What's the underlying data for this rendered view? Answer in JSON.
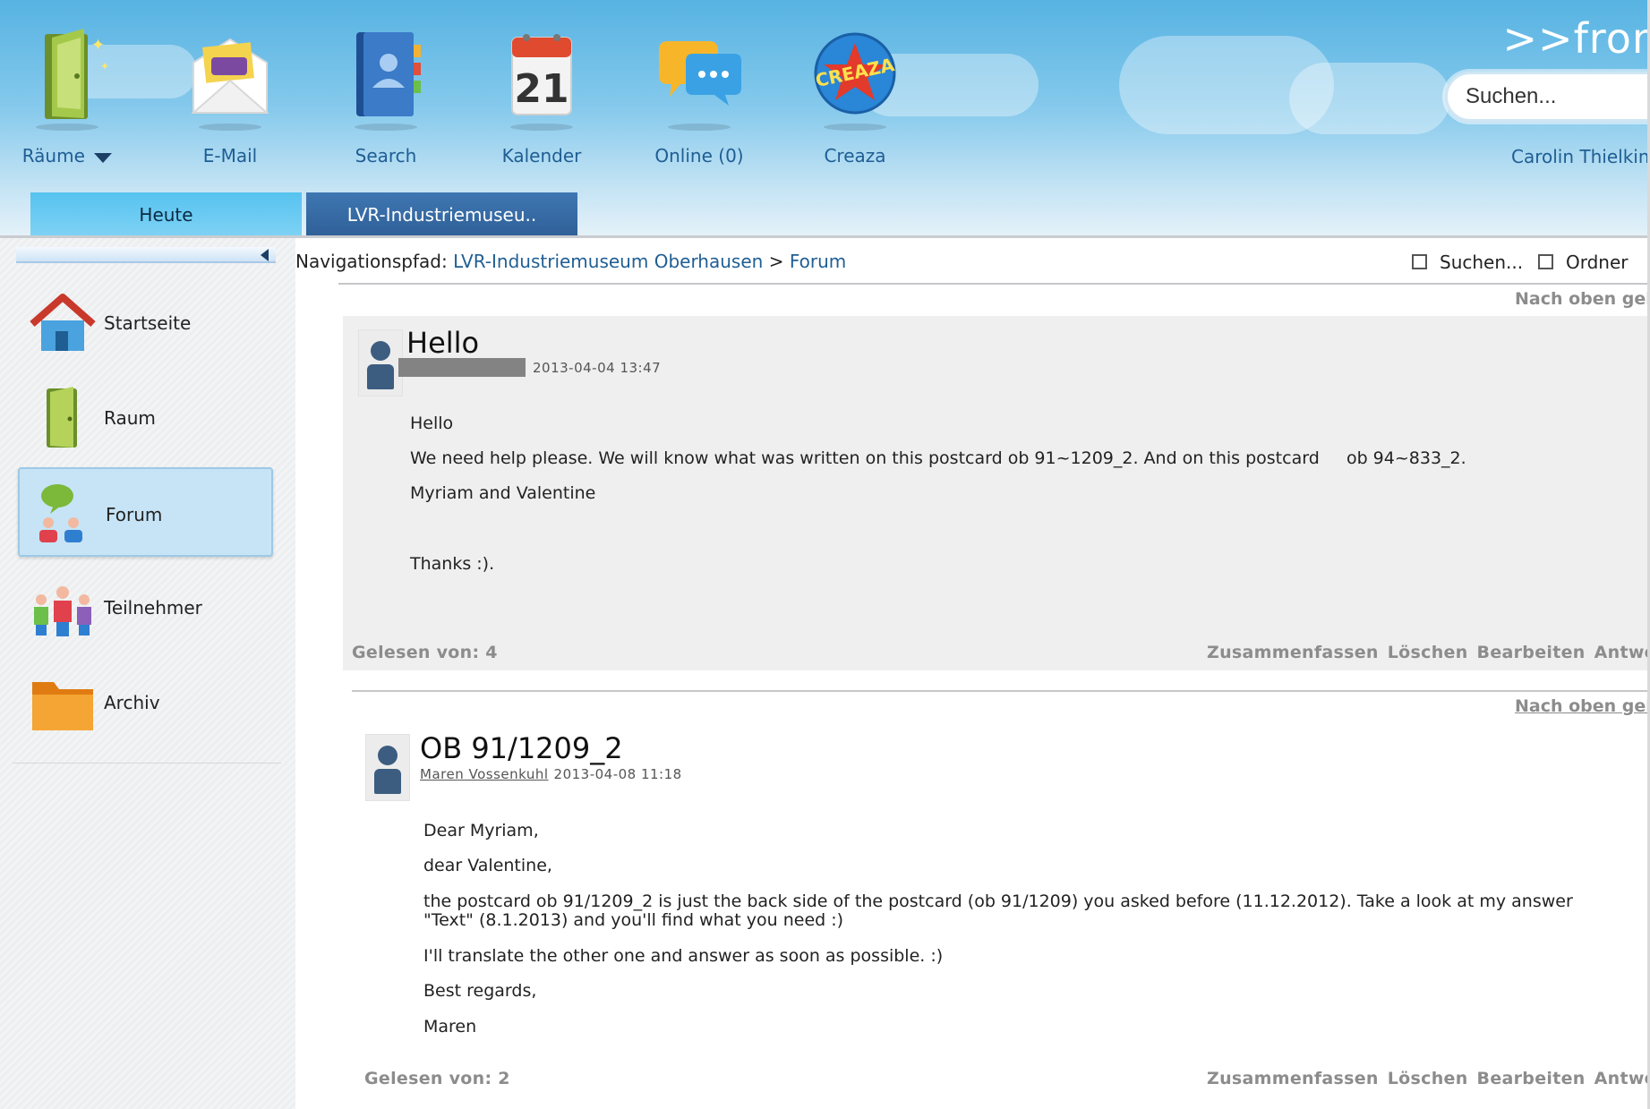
{
  "toolbar": {
    "items": [
      {
        "label": "Räume",
        "icon": "door-icon"
      },
      {
        "label": "E-Mail",
        "icon": "envelope-icon"
      },
      {
        "label": "Search",
        "icon": "address-book-icon"
      },
      {
        "label": "Kalender",
        "icon": "calendar-icon"
      },
      {
        "label": "Online (0)",
        "icon": "chat-bubbles-icon"
      },
      {
        "label": "Creaza",
        "icon": "creaza-logo-icon"
      }
    ],
    "calendar_day": "21",
    "creaza_badge": "CREAZA"
  },
  "header": {
    "brand": ">>fron",
    "search_placeholder": "Suchen...",
    "user_name": "Carolin Thielking"
  },
  "tabs": {
    "today": "Heute",
    "room": "LVR-Industriemuseu.."
  },
  "sidebar": {
    "items": [
      {
        "label": "Startseite",
        "icon": "house-icon"
      },
      {
        "label": "Raum",
        "icon": "door-icon"
      },
      {
        "label": "Forum",
        "icon": "forum-icon",
        "active": true
      },
      {
        "label": "Teilnehmer",
        "icon": "people-icon"
      },
      {
        "label": "Archiv",
        "icon": "folder-icon"
      }
    ]
  },
  "breadcrumb": {
    "prefix": "Navigationspfad:",
    "room": "LVR-Industriemuseum Oberhausen",
    "separator": ">",
    "current": "Forum"
  },
  "options": {
    "search": "Suchen...",
    "folder": "Ordner"
  },
  "posts": [
    {
      "to_top": "Nach oben gehe",
      "title": "Hello",
      "author": "",
      "date": "2013-04-04 13:47",
      "lines": [
        "Hello",
        "We need help please. We will know what was written on this postcard ob 91~1209_2. And on this postcard     ob 94~833_2.",
        "Myriam and Valentine",
        "Thanks :)."
      ],
      "read_by": "Gelesen von: 4",
      "actions": [
        "Zusammenfassen",
        "Löschen",
        "Bearbeiten",
        "Antworten"
      ]
    },
    {
      "to_top": "Nach oben gehe",
      "title": "OB 91/1209_2",
      "author": "Maren Vossenkuhl",
      "date": "2013-04-08 11:18",
      "lines": [
        "Dear Myriam,",
        "dear Valentine,",
        "the postcard ob 91/1209_2 is just the back side of the postcard (ob 91/1209) you asked before (11.12.2012). Take a look at my answer",
        "\"Text\" (8.1.2013) and you'll find what you need :)",
        "I'll translate the other one and answer as soon as possible. :)",
        "Best regards,",
        "Maren"
      ],
      "read_by": "Gelesen von: 2",
      "actions": [
        "Zusammenfassen",
        "Löschen",
        "Bearbeiten",
        "Antworten"
      ]
    }
  ],
  "colors": {
    "link": "#1f5e93",
    "tab_today": "#56c3f0",
    "tab_room": "#3f77b2",
    "muted": "#8c8c8c",
    "post_background": "#efefef"
  }
}
